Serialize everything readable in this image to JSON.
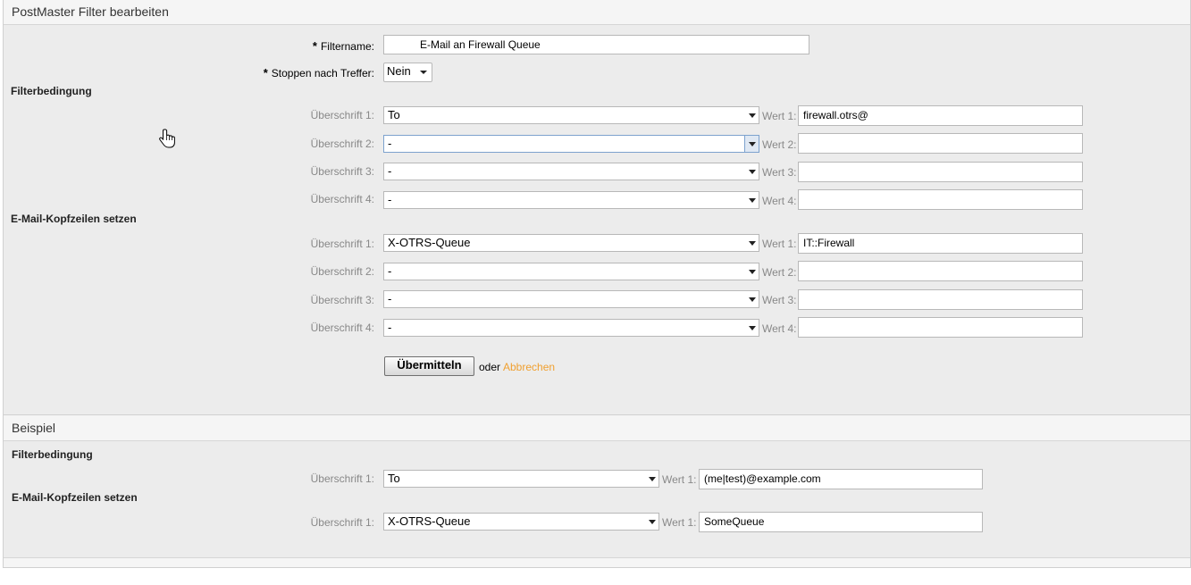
{
  "edit_panel": {
    "title": "PostMaster Filter bearbeiten",
    "filtername_label": "Filtername:",
    "filtername_value": "E-Mail an Firewall Queue",
    "stop_label": "Stoppen nach Treffer:",
    "stop_value": "Nein",
    "required_star": "*",
    "match_title": "Filterbedingung",
    "match_rows": [
      {
        "label": "Überschrift 1:",
        "header": "To",
        "wert_label": "Wert 1:",
        "value": "firewall.otrs@"
      },
      {
        "label": "Überschrift 2:",
        "header": "-",
        "wert_label": "Wert 2:",
        "value": ""
      },
      {
        "label": "Überschrift 3:",
        "header": "-",
        "wert_label": "Wert 3:",
        "value": ""
      },
      {
        "label": "Überschrift 4:",
        "header": "-",
        "wert_label": "Wert 4:",
        "value": ""
      }
    ],
    "set_title": "E-Mail-Kopfzeilen setzen",
    "set_rows": [
      {
        "label": "Überschrift 1:",
        "header": "X-OTRS-Queue",
        "wert_label": "Wert 1:",
        "value": "IT::Firewall"
      },
      {
        "label": "Überschrift 2:",
        "header": "-",
        "wert_label": "Wert 2:",
        "value": ""
      },
      {
        "label": "Überschrift 3:",
        "header": "-",
        "wert_label": "Wert 3:",
        "value": ""
      },
      {
        "label": "Überschrift 4:",
        "header": "-",
        "wert_label": "Wert 4:",
        "value": ""
      }
    ],
    "submit_label": "Übermitteln",
    "or_text": "oder",
    "cancel_label": "Abbrechen"
  },
  "example_panel": {
    "title": "Beispiel",
    "match_title": "Filterbedingung",
    "match_row": {
      "label": "Überschrift 1:",
      "header": "To",
      "wert_label": "Wert 1:",
      "value": "(me|test)@example.com"
    },
    "set_title": "E-Mail-Kopfzeilen setzen",
    "set_row": {
      "label": "Überschrift 1:",
      "header": "X-OTRS-Queue",
      "wert_label": "Wert 1:",
      "value": "SomeQueue"
    }
  },
  "icons": {
    "cursor": "hand-pointer-icon",
    "dropdown": "chevron-down-icon"
  },
  "colors": {
    "cancel_link": "#f0a030",
    "focus_border": "#7da2ce",
    "panel_bg": "#ececec"
  }
}
